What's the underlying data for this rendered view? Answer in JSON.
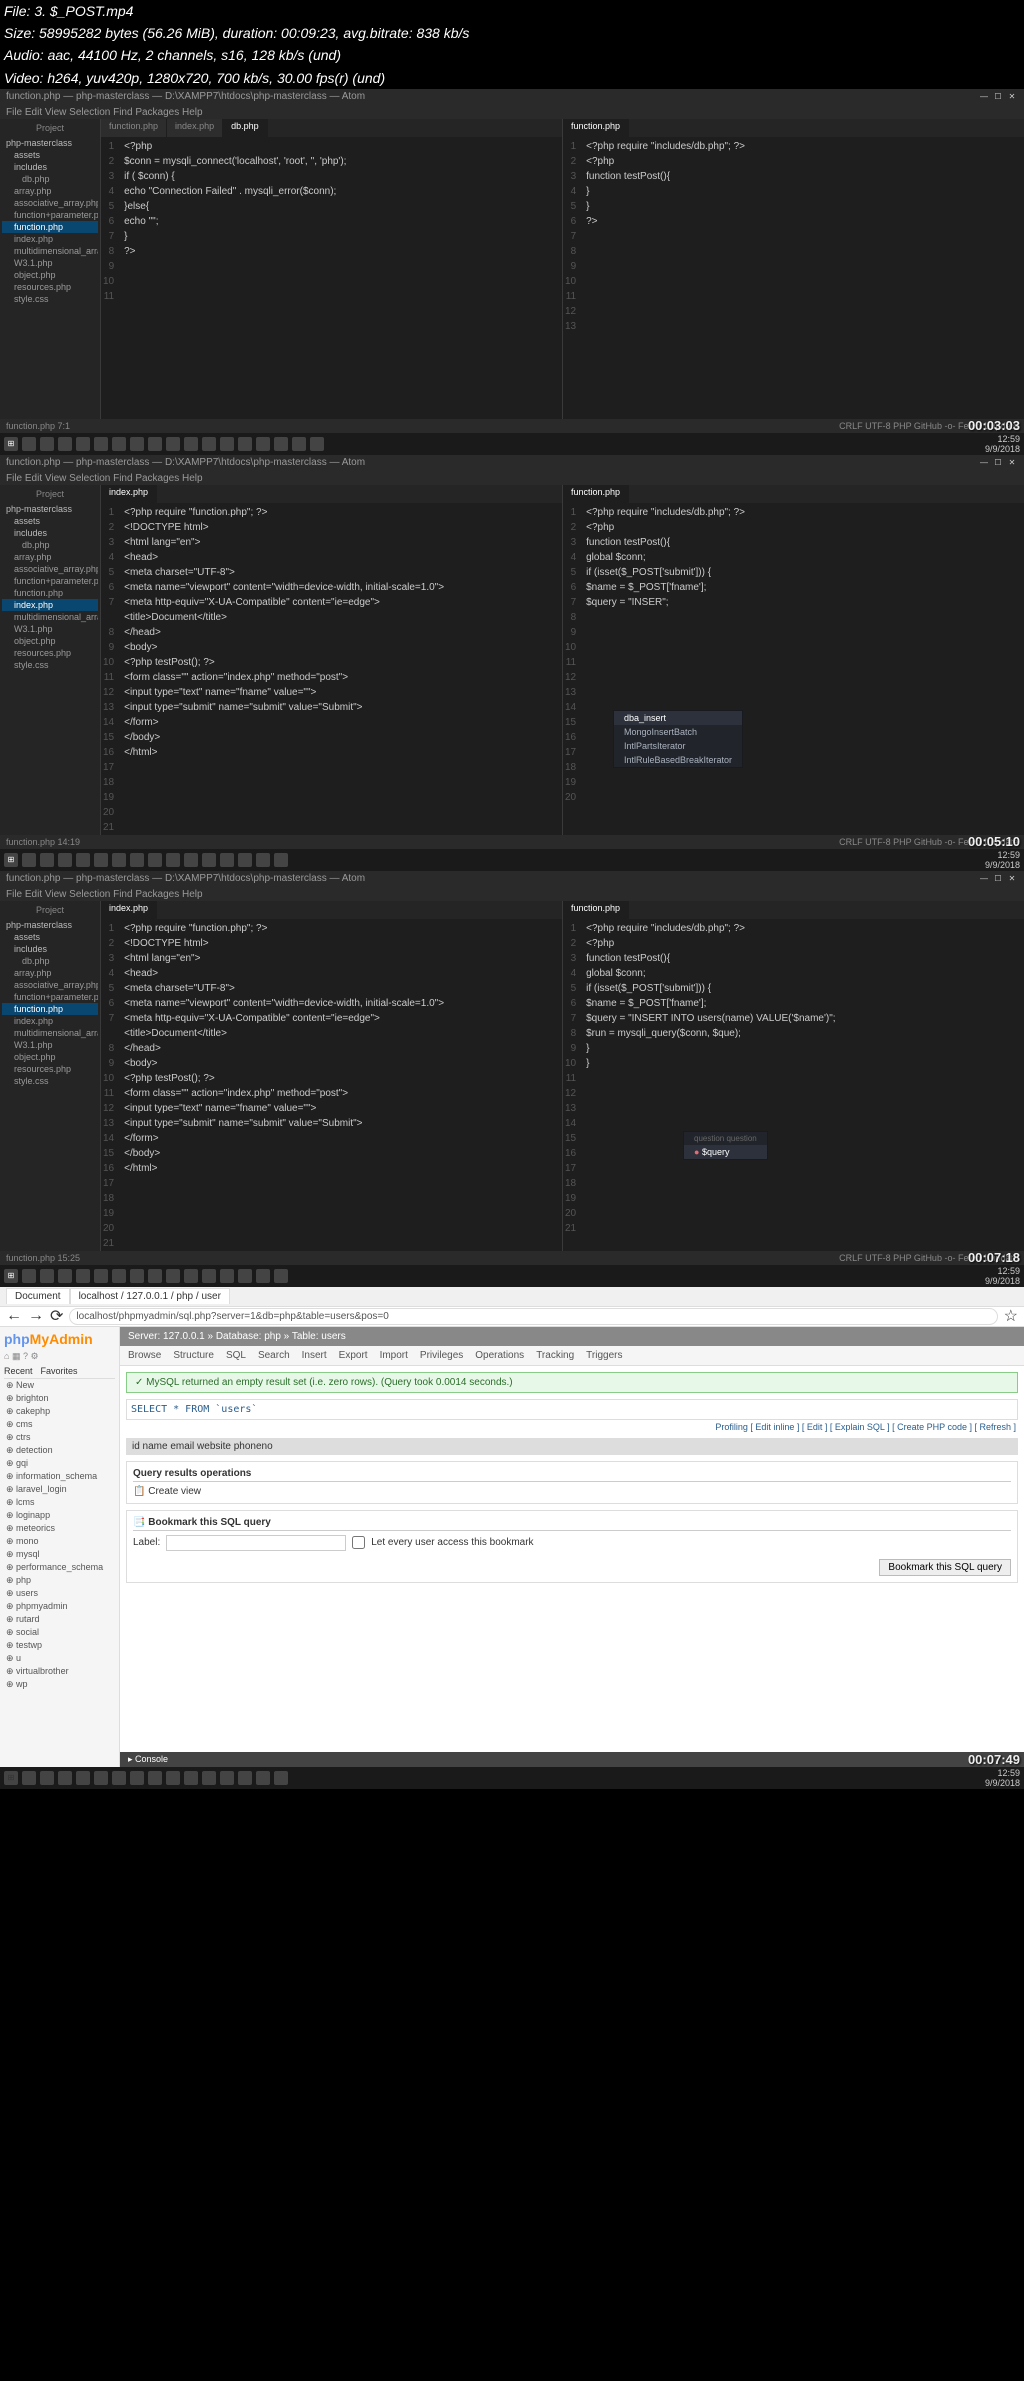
{
  "fileinfo": {
    "l1": "File: 3. $_POST.mp4",
    "l2": "Size: 58995282 bytes (56.26 MiB), duration: 00:09:23, avg.bitrate: 838 kb/s",
    "l3": "Audio: aac, 44100 Hz, 2 channels, s16, 128 kb/s (und)",
    "l4": "Video: h264, yuv420p, 1280x720, 700 kb/s, 30.00 fps(r) (und)"
  },
  "atom": {
    "title": "function.php — php-masterclass — D:\\XAMPP7\\htdocs\\php-masterclass — Atom",
    "menu": "File  Edit  View  Selection  Find  Packages  Help",
    "projectTitle": "Project",
    "tree": {
      "root": "php-masterclass",
      "assets": "assets",
      "includes": "includes",
      "dbphp": "db.php",
      "arrayphp": "array.php",
      "assocarray": "associative_array.php",
      "funcparam": "function+parameter.php",
      "functionphp": "function.php",
      "indexphp": "index.php",
      "multidim": "multidimensional_array.php",
      "w3": "W3.1.php",
      "object": "object.php",
      "resources": "resources.php",
      "stylecss": "style.css"
    },
    "tabs": {
      "function": "function.php",
      "index": "index.php",
      "db": "db.php"
    },
    "statusLeft1": "function.php    7:1",
    "statusLeft2": "function.php    14:19",
    "statusLeft3": "function.php    15:25",
    "statusRight": "CRLF   UTF-8   PHP   GitHub   -o- Fetch   1 update"
  },
  "code1": {
    "left": {
      "1": "<?php",
      "2": "",
      "3": "$conn = mysqli_connect('localhost', 'root', '', 'php');",
      "4": "",
      "5": "if ( $conn) {",
      "6": "    echo \"Connection Failed\" . mysqli_error($conn);",
      "7": "}else{",
      "8": "    echo \"\";",
      "9": "}",
      "10": "",
      "11": "?>"
    },
    "right": {
      "1": "<?php require \"includes/db.php\"; ?>",
      "2": "",
      "3": "",
      "4": "<?php",
      "5": "",
      "6": "function testPost(){",
      "7": "",
      "8": "}",
      "9": "",
      "10": "}",
      "11": "",
      "12": "?>",
      "13": ""
    }
  },
  "code2": {
    "left": {
      "1": "<?php require \"function.php\"; ?>",
      "2": "",
      "3": "<!DOCTYPE html>",
      "4": "<html lang=\"en\">",
      "5": "<head>",
      "6": "  <meta charset=\"UTF-8\">",
      "7": "  <meta name=\"viewport\" content=\"width=device-width, initial-scale=1.0\">",
      "8": "  <meta http-equiv=\"X-UA-Compatible\" content=\"ie=edge\">",
      "9": "  <title>Document</title>",
      "10": "</head>",
      "11": "<body>",
      "12": "",
      "13": "<?php testPost(); ?>",
      "14": "<form class=\"\" action=\"index.php\" method=\"post\">",
      "15": "",
      "16": "  <input type=\"text\" name=\"fname\" value=\"\">",
      "17": "  <input type=\"submit\" name=\"submit\" value=\"Submit\">",
      "18": "",
      "19": "</form>",
      "20": "",
      "21": "",
      "22": "</body>",
      "23": "</html>",
      "24": ""
    },
    "right": {
      "1": "<?php require \"includes/db.php\"; ?>",
      "2": "",
      "3": "",
      "4": "<?php",
      "5": "",
      "6": "function testPost(){",
      "7": "",
      "8": "  global $conn;",
      "9": "",
      "10": "  if (isset($_POST['submit'])) {",
      "11": "",
      "12": "    $name = $_POST['fname'];",
      "13": "",
      "14": "    $query = \"INSER\";",
      "15": "",
      "16": "",
      "17": "",
      "18": "",
      "19": "",
      "20": ""
    },
    "ac": {
      "i1": "dba_insert",
      "i2": "MongoInsertBatch",
      "i3": "IntlPartsIterator",
      "i4": "IntlRuleBasedBreakIterator"
    }
  },
  "code3": {
    "right": {
      "1": "<?php require \"includes/db.php\"; ?>",
      "2": "",
      "3": "",
      "4": "<?php",
      "5": "",
      "6": "function testPost(){",
      "7": "",
      "8": "  global $conn;",
      "9": "",
      "10": "  if (isset($_POST['submit'])) {",
      "11": "",
      "12": "    $name = $_POST['fname'];",
      "13": "",
      "14": "    $query = \"INSERT INTO users(name) VALUE('$name')\";",
      "15": "    $run = mysqli_query($conn, $que);",
      "16": "  }",
      "17": "",
      "18": "}",
      "19": "",
      "20": "",
      "21": ""
    },
    "ac": {
      "header": "question    question",
      "i1": "$query"
    }
  },
  "pma": {
    "tabDoc": "Document",
    "tabPma": "localhost / 127.0.0.1 / php / user",
    "url": "localhost/phpmyadmin/sql.php?server=1&db=php&table=users&pos=0",
    "logo": "phpMyAdmin",
    "nav": {
      "recent": "Recent",
      "fav": "Favorites"
    },
    "dbs": [
      "New",
      "brighton",
      "cakephp",
      "cms",
      "ctrs",
      "detection",
      "gqi",
      "information_schema",
      "laravel_login",
      "lcms",
      "loginapp",
      "meteorics",
      "mono",
      "mysql",
      "performance_schema",
      "php",
      "users",
      "phpmyadmin",
      "rutard",
      "social",
      "testwp",
      "u",
      "virtualbrother",
      "wp"
    ],
    "breadcrumb": "Server: 127.0.0.1 » Database: php » Table: users",
    "menu": [
      "Browse",
      "Structure",
      "SQL",
      "Search",
      "Insert",
      "Export",
      "Import",
      "Privileges",
      "Operations",
      "Tracking",
      "Triggers"
    ],
    "msg": "✓ MySQL returned an empty result set (i.e. zero rows). (Query took 0.0014 seconds.)",
    "sql": "SELECT * FROM `users`",
    "profiling": "Profiling [ Edit inline ] [ Edit ] [ Explain SQL ] [ Create PHP code ] [ Refresh ]",
    "cols": "id   name   email   website   phoneno",
    "qro": "Query results operations",
    "createview": "Create view",
    "bookmark": "Bookmark this SQL query",
    "label": "Label:",
    "letall": "Let every user access this bookmark",
    "bookmarkBtn": "Bookmark this SQL query",
    "console": "Console"
  },
  "timestamps": {
    "t1": "00:03:03",
    "t2": "00:05:10",
    "t3": "00:07:18",
    "t4": "00:07:49"
  },
  "tasktime": {
    "l1": "12:59",
    "l2": "9/9/2018"
  }
}
